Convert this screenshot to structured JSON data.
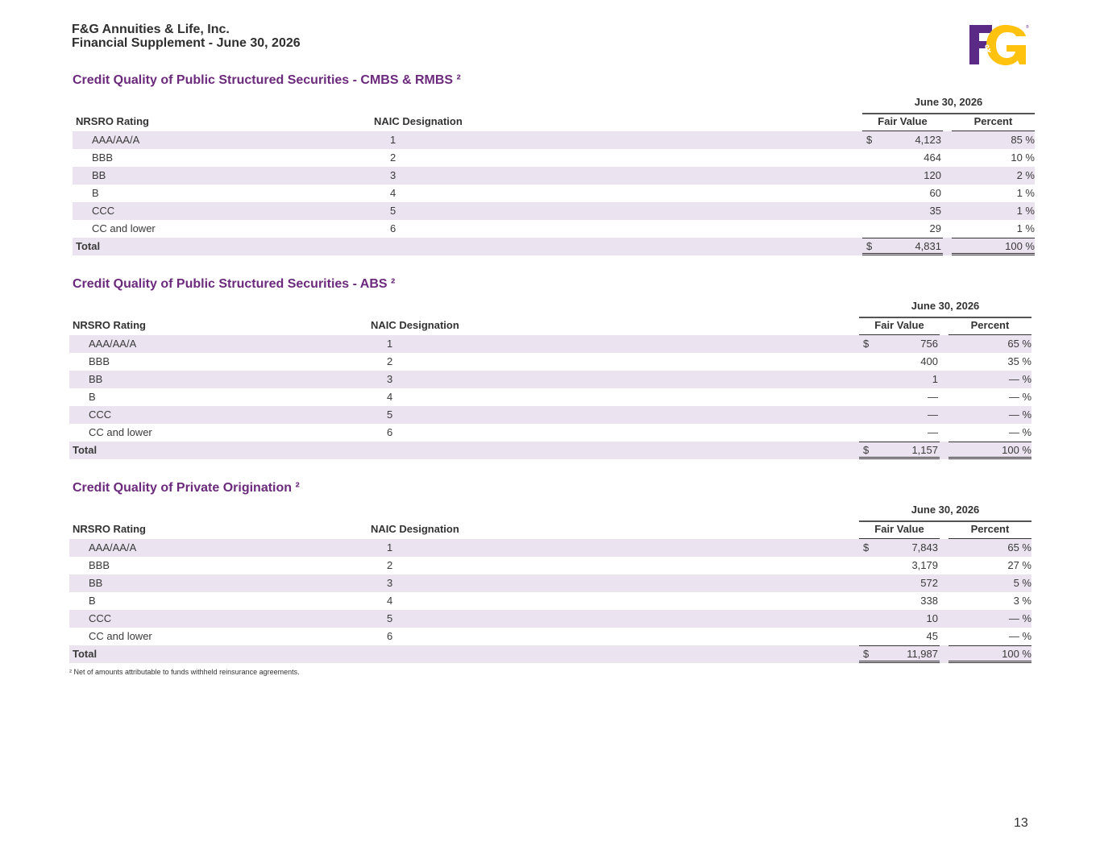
{
  "header": {
    "company": "F&G Annuities & Life, Inc.",
    "subtitle": "Financial Supplement - June 30, 2026"
  },
  "logo": {
    "text": "F&G",
    "color": "#5b2a86",
    "accent": "#ffc20e"
  },
  "column_headers": {
    "rating": "NRSRO Rating",
    "naic": "NAIC Designation",
    "fair_value": "Fair Value",
    "percent": "Percent"
  },
  "sections": [
    {
      "title": "Credit Quality of Public Structured Securities - CMBS & RMBS ²",
      "period": "June 30, 2026",
      "rows": [
        {
          "rating": "AAA/AA/A",
          "naic": "1",
          "dollar": "$",
          "fair_value": "4,123",
          "percent": "85 %"
        },
        {
          "rating": "BBB",
          "naic": "2",
          "dollar": "",
          "fair_value": "464",
          "percent": "10 %"
        },
        {
          "rating": "BB",
          "naic": "3",
          "dollar": "",
          "fair_value": "120",
          "percent": "2 %"
        },
        {
          "rating": "B",
          "naic": "4",
          "dollar": "",
          "fair_value": "60",
          "percent": "1 %"
        },
        {
          "rating": "CCC",
          "naic": "5",
          "dollar": "",
          "fair_value": "35",
          "percent": "1 %"
        },
        {
          "rating": "CC and lower",
          "naic": "6",
          "dollar": "",
          "fair_value": "29",
          "percent": "1 %"
        }
      ],
      "total": {
        "label": "Total",
        "dollar": "$",
        "fair_value": "4,831",
        "percent": "100 %"
      }
    },
    {
      "title": "Credit Quality of Public Structured Securities - ABS ²",
      "period": "June 30, 2026",
      "rows": [
        {
          "rating": "AAA/AA/A",
          "naic": "1",
          "dollar": "$",
          "fair_value": "756",
          "percent": "65 %"
        },
        {
          "rating": "BBB",
          "naic": "2",
          "dollar": "",
          "fair_value": "400",
          "percent": "35 %"
        },
        {
          "rating": "BB",
          "naic": "3",
          "dollar": "",
          "fair_value": "1",
          "percent": "— %"
        },
        {
          "rating": "B",
          "naic": "4",
          "dollar": "",
          "fair_value": "—",
          "percent": "— %"
        },
        {
          "rating": "CCC",
          "naic": "5",
          "dollar": "",
          "fair_value": "—",
          "percent": "— %"
        },
        {
          "rating": "CC and lower",
          "naic": "6",
          "dollar": "",
          "fair_value": "—",
          "percent": "— %"
        }
      ],
      "total": {
        "label": "Total",
        "dollar": "$",
        "fair_value": "1,157",
        "percent": "100 %"
      }
    },
    {
      "title": "Credit Quality of Private Origination ²",
      "period": "June 30, 2026",
      "rows": [
        {
          "rating": "AAA/AA/A",
          "naic": "1",
          "dollar": "$",
          "fair_value": "7,843",
          "percent": "65 %"
        },
        {
          "rating": "BBB",
          "naic": "2",
          "dollar": "",
          "fair_value": "3,179",
          "percent": "27 %"
        },
        {
          "rating": "BB",
          "naic": "3",
          "dollar": "",
          "fair_value": "572",
          "percent": "5 %"
        },
        {
          "rating": "B",
          "naic": "4",
          "dollar": "",
          "fair_value": "338",
          "percent": "3 %"
        },
        {
          "rating": "CCC",
          "naic": "5",
          "dollar": "",
          "fair_value": "10",
          "percent": "— %"
        },
        {
          "rating": "CC and lower",
          "naic": "6",
          "dollar": "",
          "fair_value": "45",
          "percent": "— %"
        }
      ],
      "total": {
        "label": "Total",
        "dollar": "$",
        "fair_value": "11,987",
        "percent": "100 %"
      }
    }
  ],
  "footnote": "² Net of amounts attributable to funds withheld reinsurance agreements.",
  "page_number": "13"
}
